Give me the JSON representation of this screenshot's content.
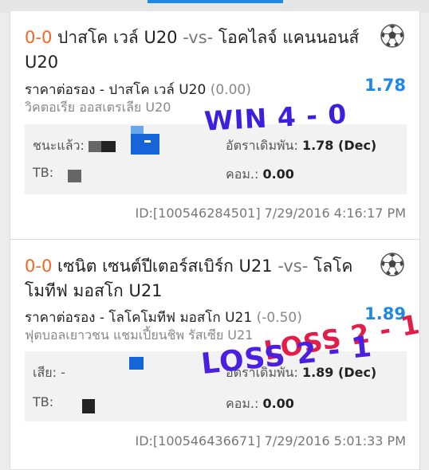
{
  "bets": [
    {
      "score": "0-0",
      "home": "ปาสโค เวล์ U20",
      "vs": "-vs-",
      "away": "โอคไลจ์ แคนนอนส์ U20",
      "market": "ราคาต่อรอง - ปาสโค เวล์ U20",
      "handicap": "(0.00)",
      "odds": "1.78",
      "league": "วิคตอเรีย ออสเตรเลีย U20",
      "status_label": "ชนะแล้ว:",
      "orig_odds_label": "อัตราเดิมพัน:",
      "orig_odds_value": "1.78 (Dec)",
      "tb_label": "TB:",
      "comm_label": "คอม.:",
      "comm_value": "0.00",
      "id": "ID:[100546284501]",
      "datetime": "7/29/2016 4:16:17 PM",
      "stamp": "WIN 4 - 0",
      "icon": "soccer-ball-icon"
    },
    {
      "score": "0-0",
      "home": "เซนิต เซนต์ปีเตอร์สเบิร์ก U21",
      "vs": "-vs-",
      "away": "โลโคโมทีฟ มอสโก U21",
      "market": "ราคาต่อรอง - โลโคโมทีฟ มอสโก U21",
      "handicap": "(-0.50)",
      "odds": "1.89",
      "league": "ฟุตบอลเยาวชน แชมเปี้ยนชิพ รัสเซีย U21",
      "status_label": "เสีย:",
      "status_value": "-",
      "orig_odds_label": "อัตราเดิมพัน:",
      "orig_odds_value": "1.89 (Dec)",
      "tb_label": "TB:",
      "comm_label": "คอม.:",
      "comm_value": "0.00",
      "id": "ID:[100546436671]",
      "datetime": "7/29/2016 5:01:33 PM",
      "stamp_red": "LOSS 2 - 1",
      "stamp_blue": "LOSS 2 - 1",
      "icon": "soccer-ball-icon"
    }
  ],
  "colors": {
    "score": "#f26522",
    "odds": "#1e88e5",
    "win_stamp": "#3d1fe0",
    "loss_stamp_red": "#e21d4a",
    "loss_stamp_blue": "#4a1fe0"
  }
}
